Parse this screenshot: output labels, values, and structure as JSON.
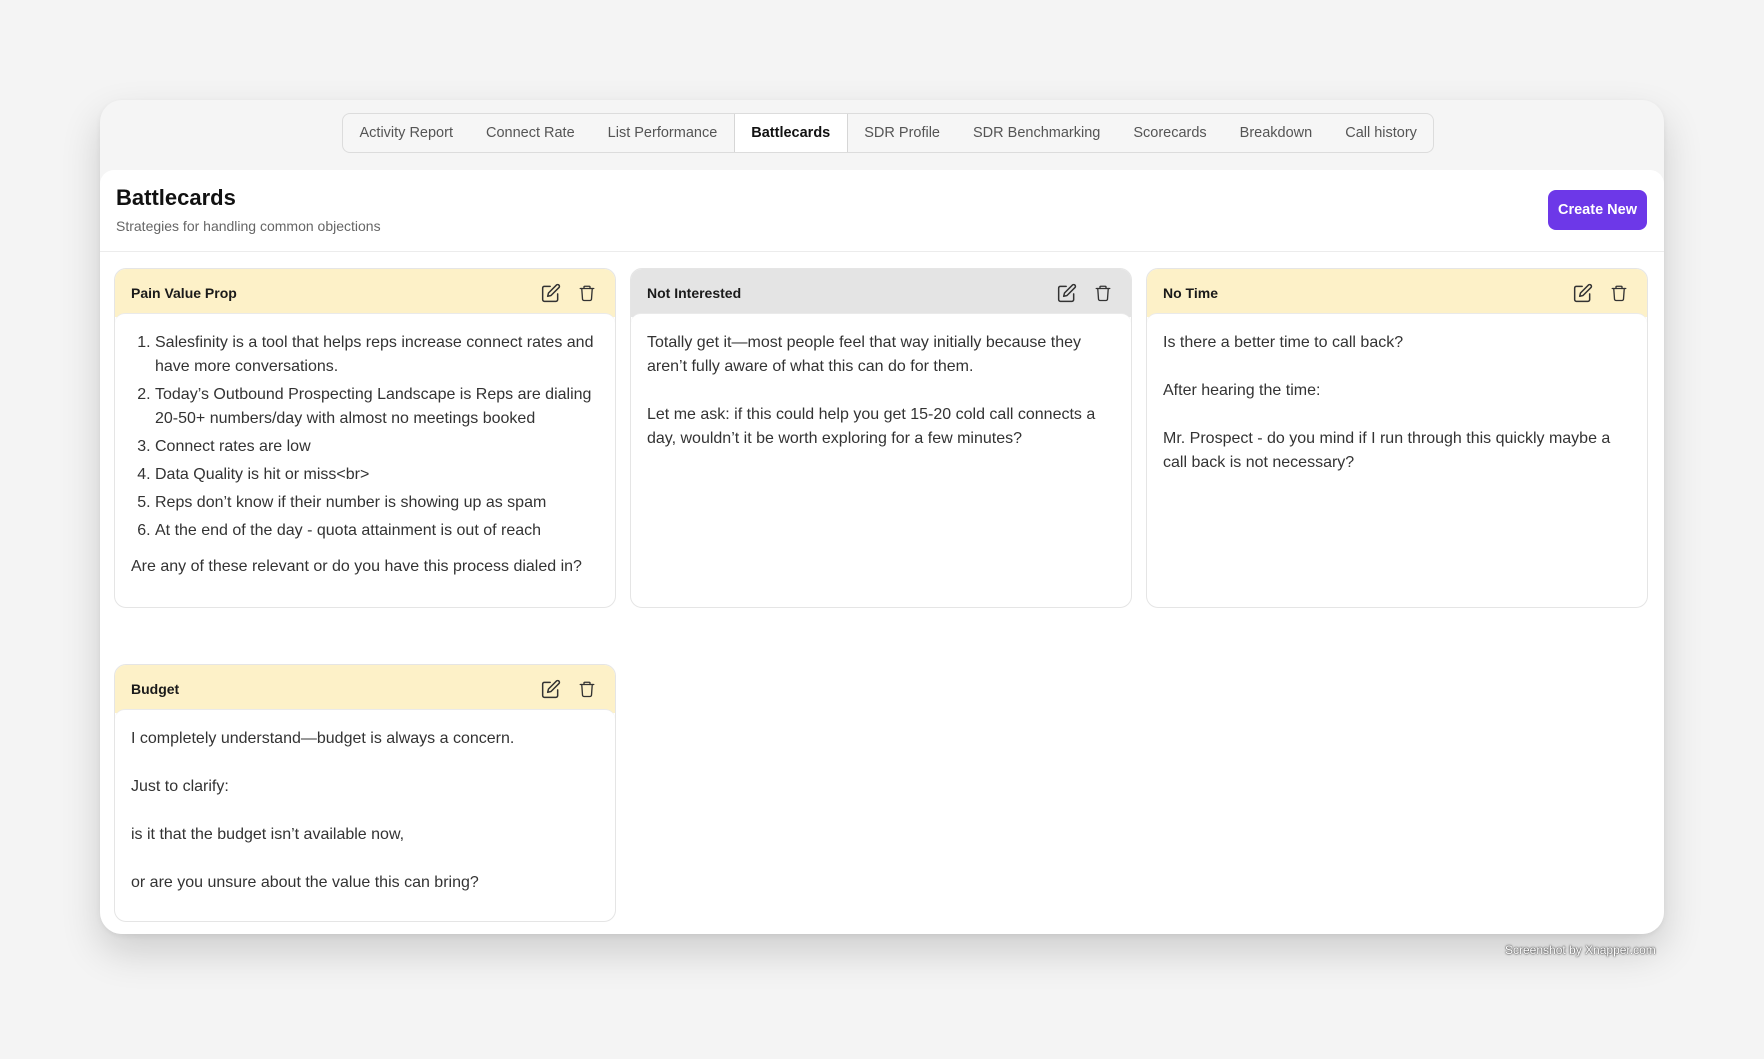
{
  "tabs": [
    "Activity Report",
    "Connect Rate",
    "List Performance",
    "Battlecards",
    "SDR Profile",
    "SDR Benchmarking",
    "Scorecards",
    "Breakdown",
    "Call history"
  ],
  "active_tab": "Battlecards",
  "header": {
    "title": "Battlecards",
    "subtitle": "Strategies for handling common objections",
    "create_label": "Create New"
  },
  "colors": {
    "accent": "#6d38e8",
    "card_header_yellow": "#fdf1c8",
    "card_header_gray": "#e4e4e4"
  },
  "cards": [
    {
      "title": "Pain Value Prop",
      "list": [
        "Salesfinity is a tool that helps reps increase connect rates and have more conversations.",
        "Today’s Outbound Prospecting Landscape is Reps are dialing 20-50+ numbers/day with almost no meetings booked",
        "Connect rates are low",
        "Data Quality is hit or miss<br>",
        "Reps don’t know if their number is showing up as spam",
        "At the end of the day - quota attainment is out of reach"
      ],
      "paragraphs": [
        "Are any of these relevant or do you have this process dialed in?"
      ]
    },
    {
      "title": "Not Interested",
      "paragraphs": [
        "Totally get it—most people feel that way initially because they aren’t fully aware of what this can do for them.",
        "Let me ask: if this could help you get 15-20 cold call connects a day, wouldn’t it be worth exploring for a few minutes?"
      ]
    },
    {
      "title": "No Time",
      "paragraphs": [
        "Is there a better time to call back?",
        "After hearing the time:",
        "Mr. Prospect - do you mind if I run through this quickly maybe a call back is not necessary?"
      ]
    },
    {
      "title": "Budget",
      "paragraphs": [
        "I completely understand—budget is always a concern.",
        "Just to clarify:",
        "is it that the budget isn’t available now,",
        "or are you unsure about the value this can bring?"
      ]
    }
  ],
  "icons": {
    "edit": "edit-icon",
    "delete": "trash-icon"
  },
  "watermark": "Screenshot by Xnapper.com"
}
